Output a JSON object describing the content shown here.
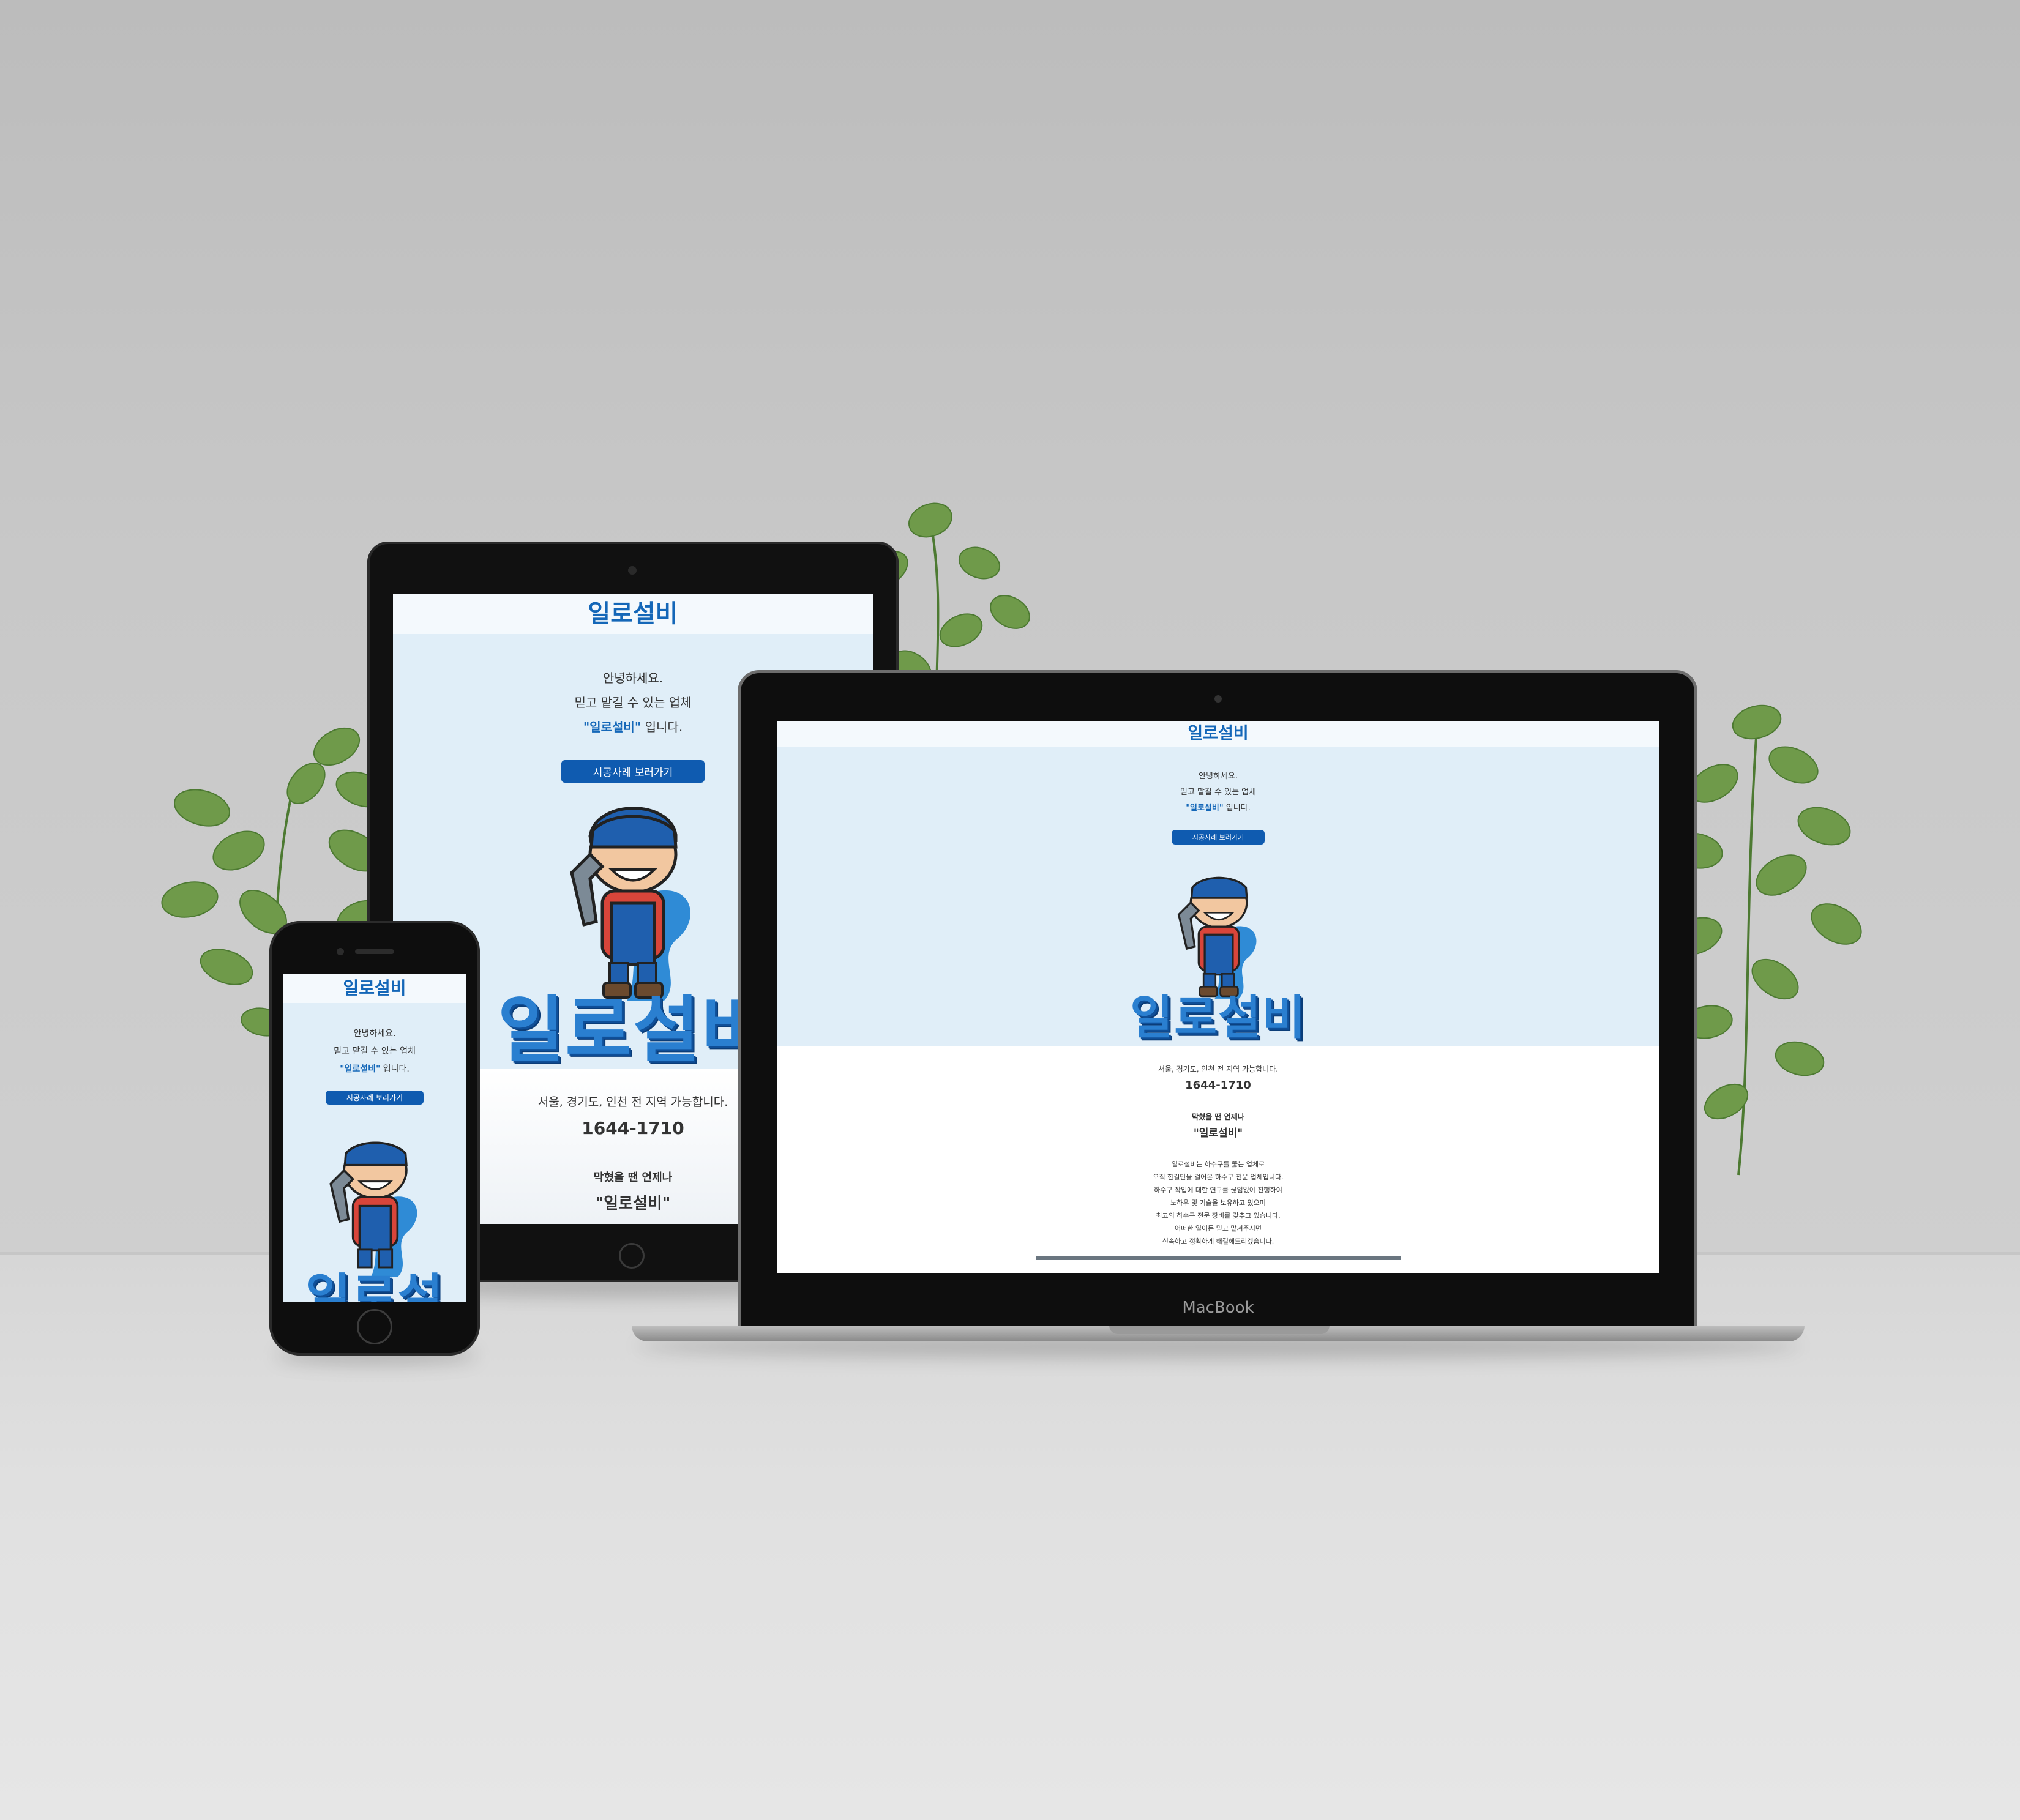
{
  "brand": "일로설비",
  "hero": {
    "line1": "안녕하세요.",
    "line2": "믿고 맡길 수 있는 업체",
    "line3_quote": "\"일로설비\"",
    "line3_rest": " 입니다.",
    "cta": "시공사례 보러가기",
    "mascot_title": "일로설비"
  },
  "contact": {
    "regions": "서울, 경기도, 인천 전 지역 가능합니다.",
    "phone": "1644-1710"
  },
  "slogan": {
    "line1": "막혔을 땐 언제나",
    "line2": "\"일로설비\""
  },
  "about": [
    "일로설비는 하수구를 뚫는 업체로",
    "오직 한길만을 걸어온 하수구 전문 업체입니다.",
    "하수구 작업에 대한 연구를 끊임없이 진행하여",
    "노하우 및 기술을 보유하고 있으며",
    "최고의 하수구 전문 장비를 갖추고 있습니다.",
    "어떠한 일이든 믿고 맡겨주시면",
    "신속하고 정확하게 해결해드리겠습니다."
  ],
  "laptop_label": "MacBook",
  "colors": {
    "accent": "#1467b8",
    "button": "#0f5bb0",
    "hero_bg": "#e0eef8",
    "header_bg": "#f4f9fd"
  }
}
